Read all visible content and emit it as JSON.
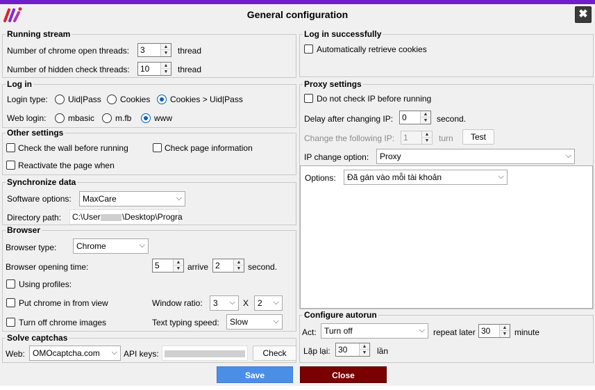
{
  "window": {
    "title": "General configuration",
    "close_glyph": "✖"
  },
  "running_stream": {
    "title": "Running stream",
    "chrome_threads_label": "Number of chrome open threads:",
    "chrome_threads_value": "3",
    "hidden_threads_label": "Number of hidden check threads:",
    "hidden_threads_value": "10",
    "unit": "thread"
  },
  "log_in": {
    "title": "Log in",
    "type_label": "Login type:",
    "types": [
      "Uid|Pass",
      "Cookies",
      "Cookies > Uid|Pass"
    ],
    "web_label": "Web login:",
    "webs": [
      "mbasic",
      "m.fb",
      "www"
    ]
  },
  "other_settings": {
    "title": "Other settings",
    "check_wall": "Check the wall before running",
    "check_page": "Check page information",
    "reactivate": "Reactivate the page when"
  },
  "sync": {
    "title": "Synchronize data",
    "software_label": "Software options:",
    "software_value": "MaxCare",
    "dir_label": "Directory path:",
    "dir_prefix": "C:\\Users",
    "dir_suffix": "\\Desktop\\Progra"
  },
  "browser": {
    "title": "Browser",
    "type_label": "Browser type:",
    "type_value": "Chrome",
    "open_time_label": "Browser opening time:",
    "open_time_from": "5",
    "arrive_label": "arrive",
    "open_time_to": "2",
    "second_label": "second.",
    "using_profiles": "Using profiles:",
    "put_chrome": "Put chrome in from view",
    "window_ratio_label": "Window ratio:",
    "window_ratio_w": "3",
    "x_label": "X",
    "window_ratio_h": "2",
    "turn_off_images": "Turn off chrome images",
    "typing_label": "Text typing speed:",
    "typing_value": "Slow"
  },
  "captcha": {
    "title": "Solve captchas",
    "web_label": "Web:",
    "web_value": "OMOcaptcha.com",
    "api_label": "API keys:",
    "check_button": "Check"
  },
  "login_success": {
    "title": "Log in successfully",
    "auto_cookies": "Automatically retrieve cookies"
  },
  "proxy": {
    "title": "Proxy settings",
    "no_check_ip": "Do not check IP before running",
    "delay_label": "Delay after changing IP:",
    "delay_value": "0",
    "delay_unit": "second.",
    "change_following_label": "Change the following IP:",
    "change_following_value": "1",
    "change_following_unit": "turn",
    "test_button": "Test",
    "ip_option_label": "IP change option:",
    "ip_option_value": "Proxy",
    "options_label": "Options:",
    "options_value": "Đã gán vào mỗi tài khoản"
  },
  "autorun": {
    "title": "Configure autorun",
    "act_label": "Act:",
    "act_value": "Turn off",
    "repeat_label": "repeat later",
    "repeat_value": "30",
    "repeat_unit": "minute",
    "again_label": "Lặp lại:",
    "again_value": "30",
    "again_unit": "lần"
  },
  "footer": {
    "save": "Save",
    "close": "Close"
  },
  "colors": {
    "accent": "#6f1fc8",
    "save": "#4a8ee8",
    "close": "#7a0000",
    "radio_on": "#0060c0"
  }
}
